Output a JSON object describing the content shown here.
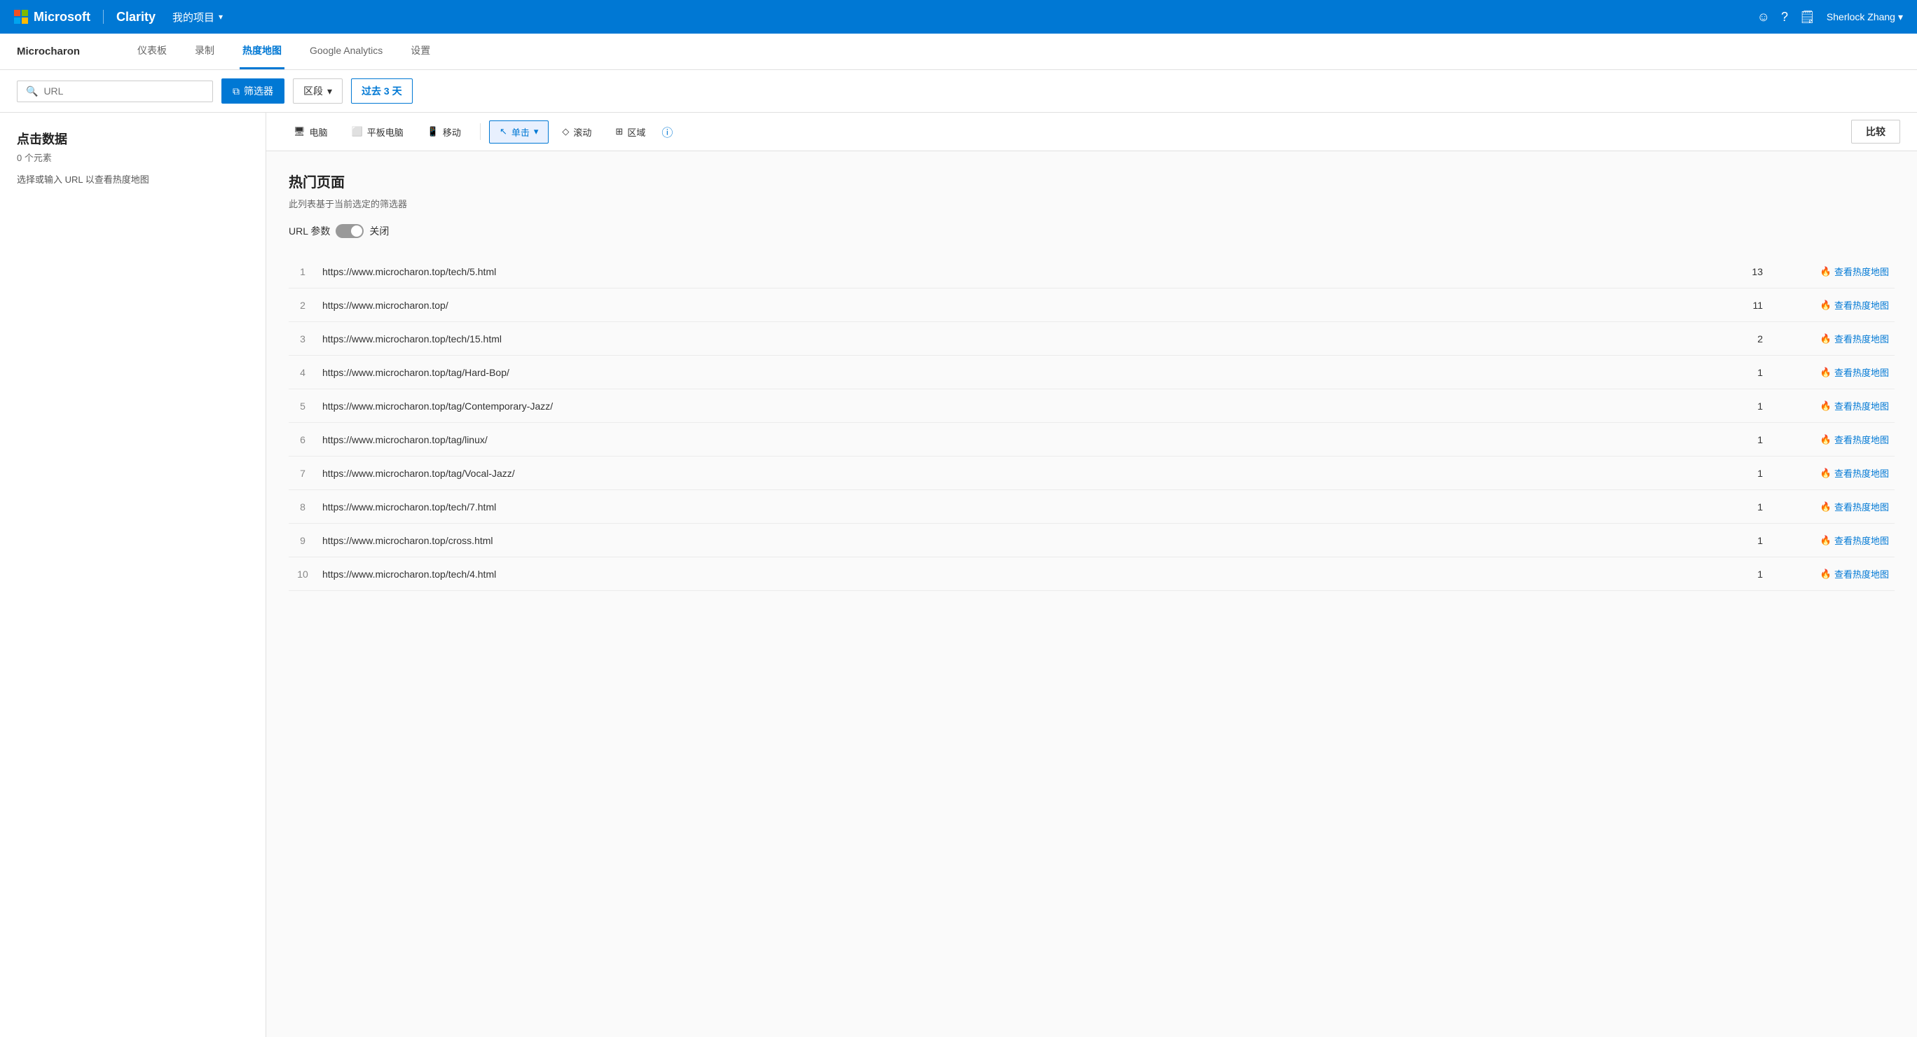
{
  "app": {
    "logo_text": "Microsoft",
    "clarity_text": "Clarity",
    "project_label": "我的项目",
    "user_name": "Sherlock Zhang"
  },
  "nav": {
    "project_name": "Microcharon",
    "tabs": [
      {
        "label": "仪表板",
        "active": false
      },
      {
        "label": "录制",
        "active": false
      },
      {
        "label": "热度地图",
        "active": true
      },
      {
        "label": "Google Analytics",
        "active": false
      },
      {
        "label": "设置",
        "active": false
      }
    ]
  },
  "filter_bar": {
    "search_placeholder": "URL",
    "filter_btn_label": "筛选器",
    "segment_btn_label": "区段",
    "date_btn_label": "过去 3 天"
  },
  "left_panel": {
    "title": "点击数据",
    "subtitle": "0 个元素",
    "hint": "选择或输入 URL 以查看热度地图"
  },
  "device_toolbar": {
    "devices": [
      {
        "label": "电脑",
        "icon": "🖥"
      },
      {
        "label": "平板电脑",
        "icon": "⬜"
      },
      {
        "label": "移动",
        "icon": "📱"
      }
    ],
    "actions": [
      {
        "label": "单击",
        "active": true
      },
      {
        "label": "滚动",
        "active": false
      },
      {
        "label": "区域",
        "active": false
      }
    ],
    "compare_label": "比较"
  },
  "content": {
    "section_title": "热门页面",
    "section_sub": "此列表基于当前选定的筛选器",
    "url_params_label": "URL 参数",
    "toggle_state": "关闭",
    "rows": [
      {
        "num": 1,
        "url": "https://www.microcharon.top/tech/5.html",
        "count": 13,
        "action": "查看热度地图"
      },
      {
        "num": 2,
        "url": "https://www.microcharon.top/",
        "count": 11,
        "action": "查看热度地图"
      },
      {
        "num": 3,
        "url": "https://www.microcharon.top/tech/15.html",
        "count": 2,
        "action": "查看热度地图"
      },
      {
        "num": 4,
        "url": "https://www.microcharon.top/tag/Hard-Bop/",
        "count": 1,
        "action": "查看热度地图"
      },
      {
        "num": 5,
        "url": "https://www.microcharon.top/tag/Contemporary-Jazz/",
        "count": 1,
        "action": "查看热度地图"
      },
      {
        "num": 6,
        "url": "https://www.microcharon.top/tag/linux/",
        "count": 1,
        "action": "查看热度地图"
      },
      {
        "num": 7,
        "url": "https://www.microcharon.top/tag/Vocal-Jazz/",
        "count": 1,
        "action": "查看热度地图"
      },
      {
        "num": 8,
        "url": "https://www.microcharon.top/tech/7.html",
        "count": 1,
        "action": "查看热度地图"
      },
      {
        "num": 9,
        "url": "https://www.microcharon.top/cross.html",
        "count": 1,
        "action": "查看热度地图"
      },
      {
        "num": 10,
        "url": "https://www.microcharon.top/tech/4.html",
        "count": 1,
        "action": "查看热度地图"
      }
    ]
  }
}
